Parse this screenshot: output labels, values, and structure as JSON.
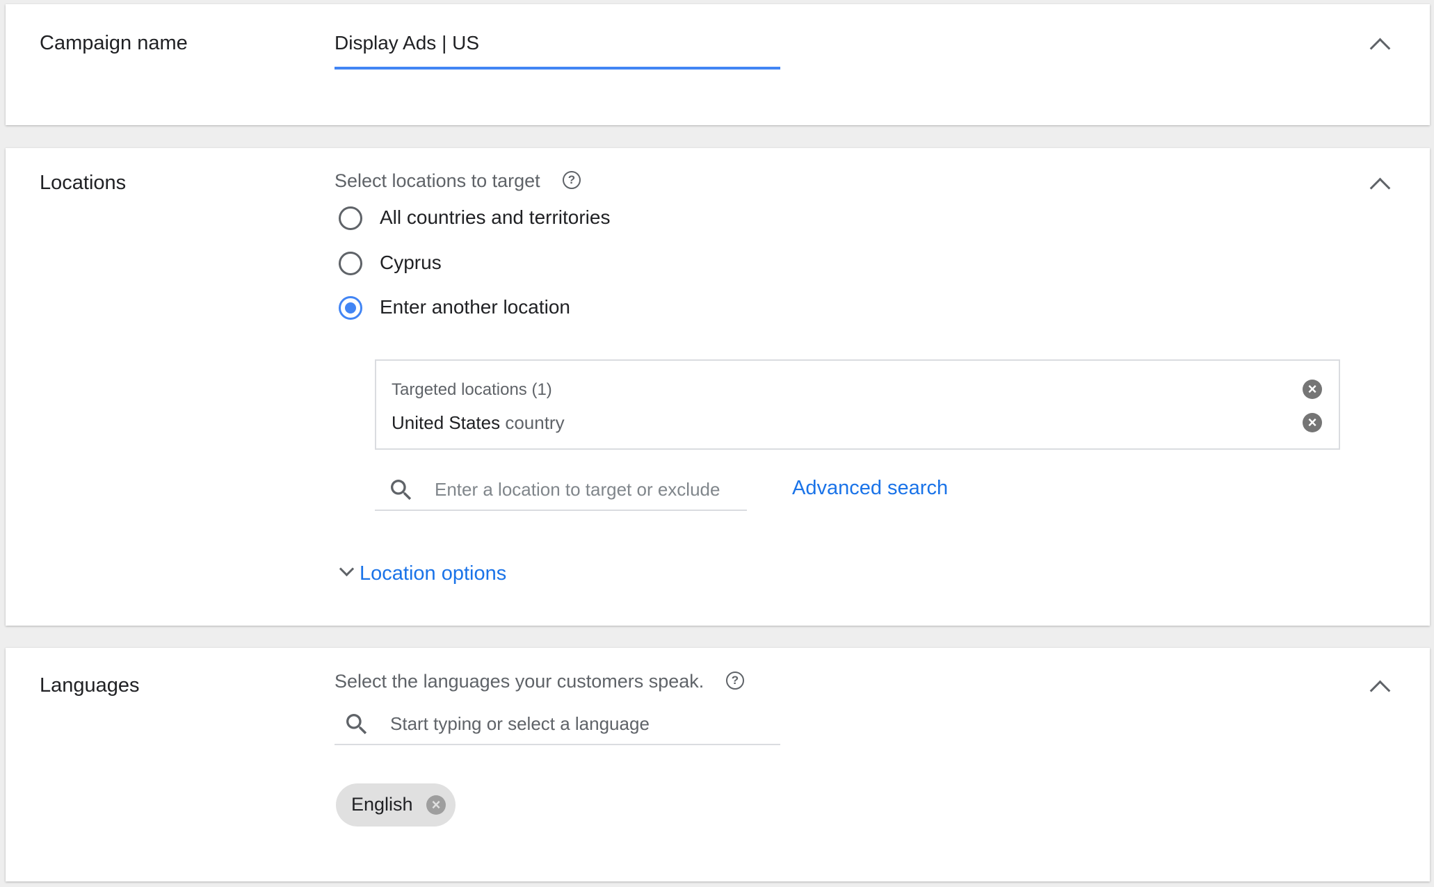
{
  "campaign_name": {
    "label": "Campaign name",
    "value": "Display Ads | US",
    "accent": "#4285f4"
  },
  "locations": {
    "label": "Locations",
    "prompt": "Select locations to target",
    "help_icon": "help-circle-icon",
    "options": [
      {
        "label": "All countries and territories",
        "selected": false
      },
      {
        "label": "Cyprus",
        "selected": false
      },
      {
        "label": "Enter another location",
        "selected": true
      }
    ],
    "targeted_header": "Targeted locations (1)",
    "targeted_items": [
      {
        "name": "United States",
        "type": "country"
      }
    ],
    "search_placeholder": "Enter a location to target or exclude",
    "advanced_search": "Advanced search",
    "location_options": "Location options"
  },
  "languages": {
    "label": "Languages",
    "prompt": "Select the languages your customers speak.",
    "search_placeholder": "Start typing or select a language",
    "chips": [
      "English"
    ]
  },
  "colors": {
    "link": "#1a73e8",
    "accent": "#4285f4"
  }
}
